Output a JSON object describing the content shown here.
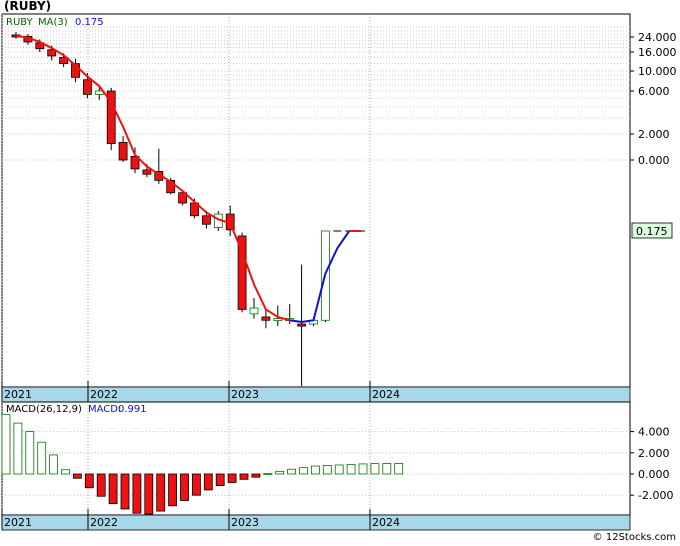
{
  "ticker": "(RUBY)",
  "footer": "© 12Stocks.com",
  "colors": {
    "down": "#ee1111",
    "up": "#007700",
    "ma_red": "#ee1111",
    "ma_blue": "#1111cc",
    "axis_band": "#a8d8e8",
    "grid": "#bbbbbb",
    "label_bg": "#ddffdd"
  },
  "chart_data": [
    {
      "type": "candlestick",
      "scale": "log",
      "legend": {
        "symbol": "RUBY",
        "ma_label": "MA(3)",
        "ma_value": "0.175"
      },
      "last_label": "0.175",
      "y_ticks": [
        "24.000",
        "16.000",
        "10.000",
        "6.000",
        "2.000",
        "0.000"
      ],
      "x_ticks": [
        "2021",
        "2022",
        "2023",
        "2024"
      ],
      "grid": true,
      "candles": [
        {
          "x": 0,
          "o": 25.5,
          "h": 27.5,
          "l": 23.0,
          "c": 24.0
        },
        {
          "x": 1,
          "o": 24.5,
          "h": 26.0,
          "l": 19.5,
          "c": 21.0
        },
        {
          "x": 2,
          "o": 20.5,
          "h": 22.5,
          "l": 16.0,
          "c": 17.5
        },
        {
          "x": 3,
          "o": 17.0,
          "h": 19.0,
          "l": 13.0,
          "c": 14.5
        },
        {
          "x": 4,
          "o": 14.0,
          "h": 15.5,
          "l": 11.0,
          "c": 12.0
        },
        {
          "x": 5,
          "o": 12.0,
          "h": 13.5,
          "l": 7.5,
          "c": 8.5
        },
        {
          "x": 6,
          "o": 8.0,
          "h": 9.5,
          "l": 5.0,
          "c": 5.5
        },
        {
          "x": 7,
          "o": 5.5,
          "h": 7.0,
          "l": 4.8,
          "c": 6.0
        },
        {
          "x": 8,
          "o": 6.0,
          "h": 6.5,
          "l": 1.3,
          "c": 1.55
        },
        {
          "x": 9,
          "o": 1.6,
          "h": 1.9,
          "l": 0.95,
          "c": 1.0
        },
        {
          "x": 10,
          "o": 1.1,
          "h": 1.4,
          "l": 0.72,
          "c": 0.8
        },
        {
          "x": 11,
          "o": 0.78,
          "h": 0.9,
          "l": 0.65,
          "c": 0.7
        },
        {
          "x": 12,
          "o": 0.75,
          "h": 1.35,
          "l": 0.55,
          "c": 0.6
        },
        {
          "x": 13,
          "o": 0.6,
          "h": 0.64,
          "l": 0.42,
          "c": 0.44
        },
        {
          "x": 14,
          "o": 0.44,
          "h": 0.47,
          "l": 0.32,
          "c": 0.34
        },
        {
          "x": 15,
          "o": 0.34,
          "h": 0.38,
          "l": 0.235,
          "c": 0.25
        },
        {
          "x": 16,
          "o": 0.25,
          "h": 0.28,
          "l": 0.185,
          "c": 0.205
        },
        {
          "x": 17,
          "o": 0.19,
          "h": 0.28,
          "l": 0.175,
          "c": 0.26
        },
        {
          "x": 18,
          "o": 0.26,
          "h": 0.32,
          "l": 0.16,
          "c": 0.18
        },
        {
          "x": 19,
          "o": 0.16,
          "h": 0.17,
          "l": 0.039,
          "c": 0.041
        },
        {
          "x": 20,
          "o": 0.038,
          "h": 0.05,
          "l": 0.035,
          "c": 0.042
        },
        {
          "x": 21,
          "o": 0.036,
          "h": 0.041,
          "l": 0.03,
          "c": 0.034
        },
        {
          "x": 22,
          "o": 0.034,
          "h": 0.044,
          "l": 0.031,
          "c": 0.035
        },
        {
          "x": 23,
          "o": 0.034,
          "h": 0.045,
          "l": 0.032,
          "c": 0.035
        },
        {
          "x": 24,
          "o": 0.032,
          "h": 0.095,
          "l": 0.012,
          "c": 0.031
        },
        {
          "x": 25,
          "o": 0.032,
          "h": 0.036,
          "l": 0.031,
          "c": 0.034
        },
        {
          "x": 26,
          "o": 0.034,
          "h": 0.175,
          "l": 0.033,
          "c": 0.175
        },
        {
          "x": 27,
          "o": 0.175,
          "h": 0.176,
          "l": 0.174,
          "c": 0.175
        },
        {
          "x": 28,
          "o": 0.175,
          "h": 0.175,
          "l": 0.175,
          "c": 0.175
        },
        {
          "x": 29,
          "o": 0.175,
          "h": 0.175,
          "l": 0.175,
          "c": 0.175
        }
      ],
      "ma3": [
        25.0,
        23.5,
        21.0,
        17.8,
        14.8,
        11.5,
        8.7,
        6.8,
        4.5,
        2.4,
        1.15,
        0.85,
        0.7,
        0.58,
        0.46,
        0.35,
        0.27,
        0.23,
        0.21,
        0.12,
        0.065,
        0.041,
        0.036,
        0.034,
        0.033,
        0.034,
        0.08,
        0.128,
        0.175,
        0.175
      ]
    },
    {
      "type": "bar",
      "legend": {
        "label": "MACD(26,12,9)",
        "value_label": "MACD:",
        "value": "0.991"
      },
      "y_ticks": [
        "4.000",
        "2.000",
        "0.000",
        "-2.000"
      ],
      "x_ticks": [
        "2021",
        "2022",
        "2023",
        "2024"
      ],
      "ylim": [
        -4.0,
        5.5
      ],
      "values": [
        5.6,
        4.8,
        4.0,
        3.0,
        1.8,
        0.4,
        -0.4,
        -1.3,
        -2.1,
        -2.8,
        -3.3,
        -3.7,
        -3.9,
        -3.5,
        -3.0,
        -2.5,
        -2.0,
        -1.5,
        -1.1,
        -0.8,
        -0.5,
        -0.3,
        0.05,
        0.25,
        0.45,
        0.6,
        0.75,
        0.8,
        0.85,
        0.9,
        0.95,
        0.98,
        0.99,
        0.991
      ]
    }
  ]
}
